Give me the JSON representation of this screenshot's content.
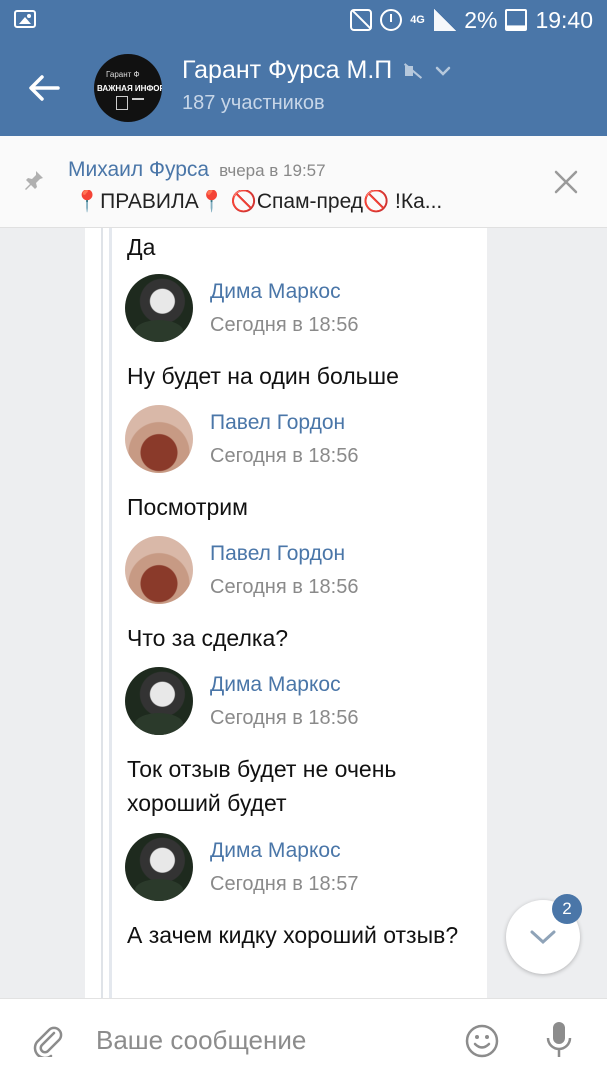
{
  "status_bar": {
    "battery": "2%",
    "time": "19:40",
    "network": "4G"
  },
  "header": {
    "title": "Гарант Фурса М.П",
    "subtitle": "187 участников",
    "avatar_text_1": "Гарант Ф",
    "avatar_text_2": "ВАЖНАЯ ИНФОРМАЦ"
  },
  "pinned": {
    "author": "Михаил Фурса",
    "time": "вчера в 19:57",
    "text": "📍ПРАВИЛА📍 🚫Спам-пред🚫 !Ка..."
  },
  "messages": [
    {
      "type": "text",
      "text": "Да"
    },
    {
      "type": "head",
      "author": "Дима Маркос",
      "time": "Сегодня в 18:56",
      "avatar": "dima"
    },
    {
      "type": "text",
      "text": "Ну будет на один больше"
    },
    {
      "type": "head",
      "author": "Павел Гордон",
      "time": "Сегодня в 18:56",
      "avatar": "pavel"
    },
    {
      "type": "text",
      "text": "Посмотрим"
    },
    {
      "type": "head",
      "author": "Павел Гордон",
      "time": "Сегодня в 18:56",
      "avatar": "pavel"
    },
    {
      "type": "text",
      "text": "Что за сделка?"
    },
    {
      "type": "head",
      "author": "Дима Маркос",
      "time": "Сегодня в 18:56",
      "avatar": "dima"
    },
    {
      "type": "text",
      "text": "Ток отзыв будет не очень хороший будет"
    },
    {
      "type": "head",
      "author": "Дима Маркос",
      "time": "Сегодня в 18:57",
      "avatar": "dima"
    },
    {
      "type": "text",
      "text": "А зачем кидку хороший отзыв?"
    }
  ],
  "scroll_button": {
    "badge": "2"
  },
  "composer": {
    "placeholder": "Ваше сообщение"
  },
  "colors": {
    "accent": "#4a76a8",
    "background": "#edeef0"
  }
}
